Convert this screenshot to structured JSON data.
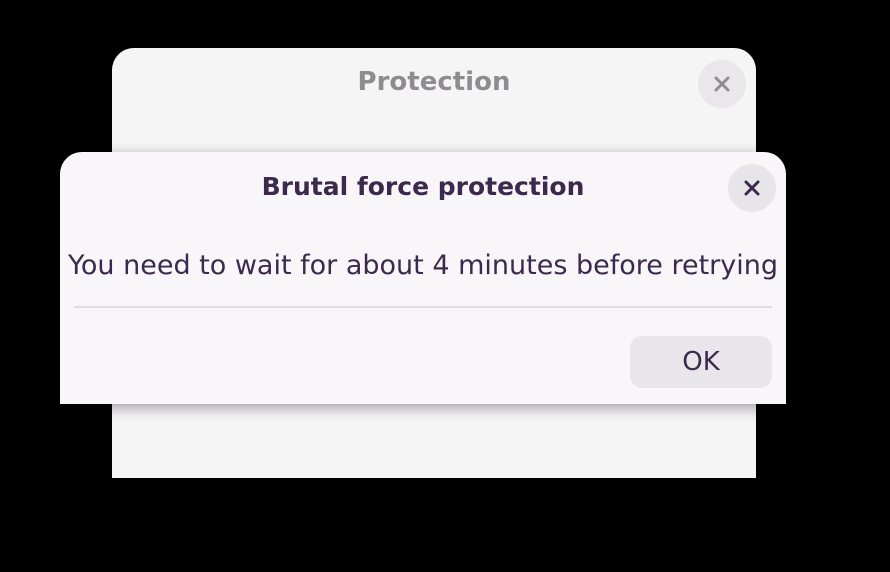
{
  "background_window": {
    "title": "Protection",
    "close_icon": "close-icon"
  },
  "dialog": {
    "title": "Brutal force protection",
    "message": "You need to wait for about 4 minutes before retrying",
    "ok_label": "OK",
    "close_icon": "close-icon"
  },
  "colors": {
    "text_primary": "#3c2a4d",
    "text_muted": "#8e8c8f",
    "dialog_bg": "#f8f6f9",
    "button_bg": "#e9e6eb",
    "backdrop": "#000000"
  }
}
